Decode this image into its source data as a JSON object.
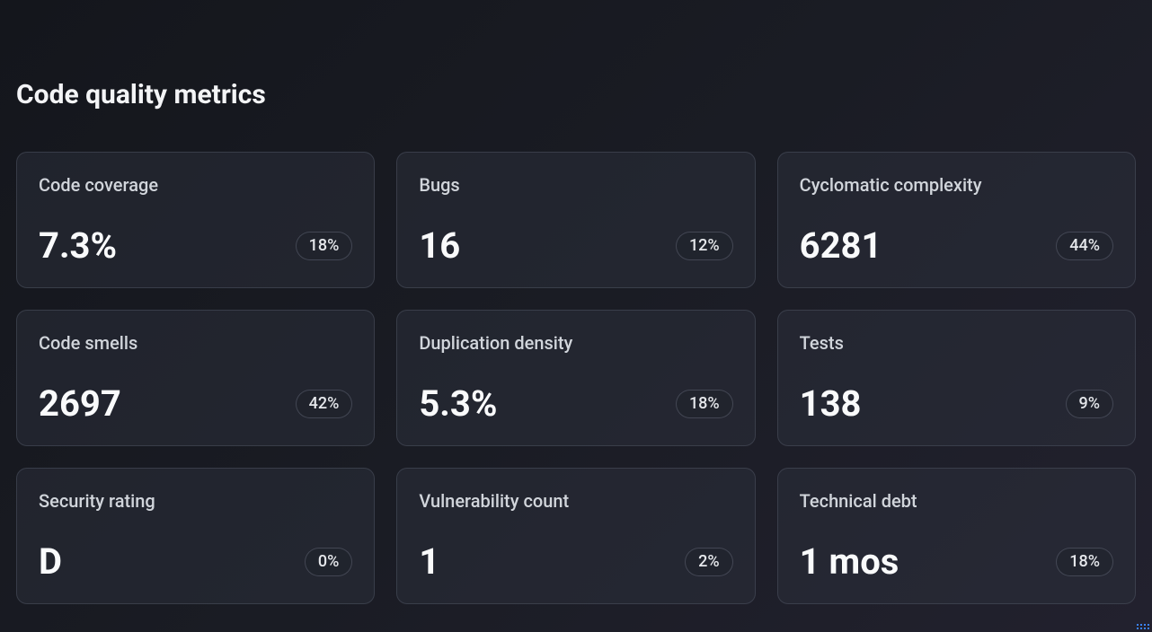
{
  "title": "Code quality metrics",
  "metrics": [
    {
      "label": "Code coverage",
      "value": "7.3%",
      "badge": "18%"
    },
    {
      "label": "Bugs",
      "value": "16",
      "badge": "12%"
    },
    {
      "label": "Cyclomatic complexity",
      "value": "6281",
      "badge": "44%"
    },
    {
      "label": "Code smells",
      "value": "2697",
      "badge": "42%"
    },
    {
      "label": "Duplication density",
      "value": "5.3%",
      "badge": "18%"
    },
    {
      "label": "Tests",
      "value": "138",
      "badge": "9%"
    },
    {
      "label": "Security rating",
      "value": "D",
      "badge": "0%"
    },
    {
      "label": "Vulnerability count",
      "value": "1",
      "badge": "2%"
    },
    {
      "label": "Technical debt",
      "value": "1 mos",
      "badge": "18%"
    }
  ]
}
